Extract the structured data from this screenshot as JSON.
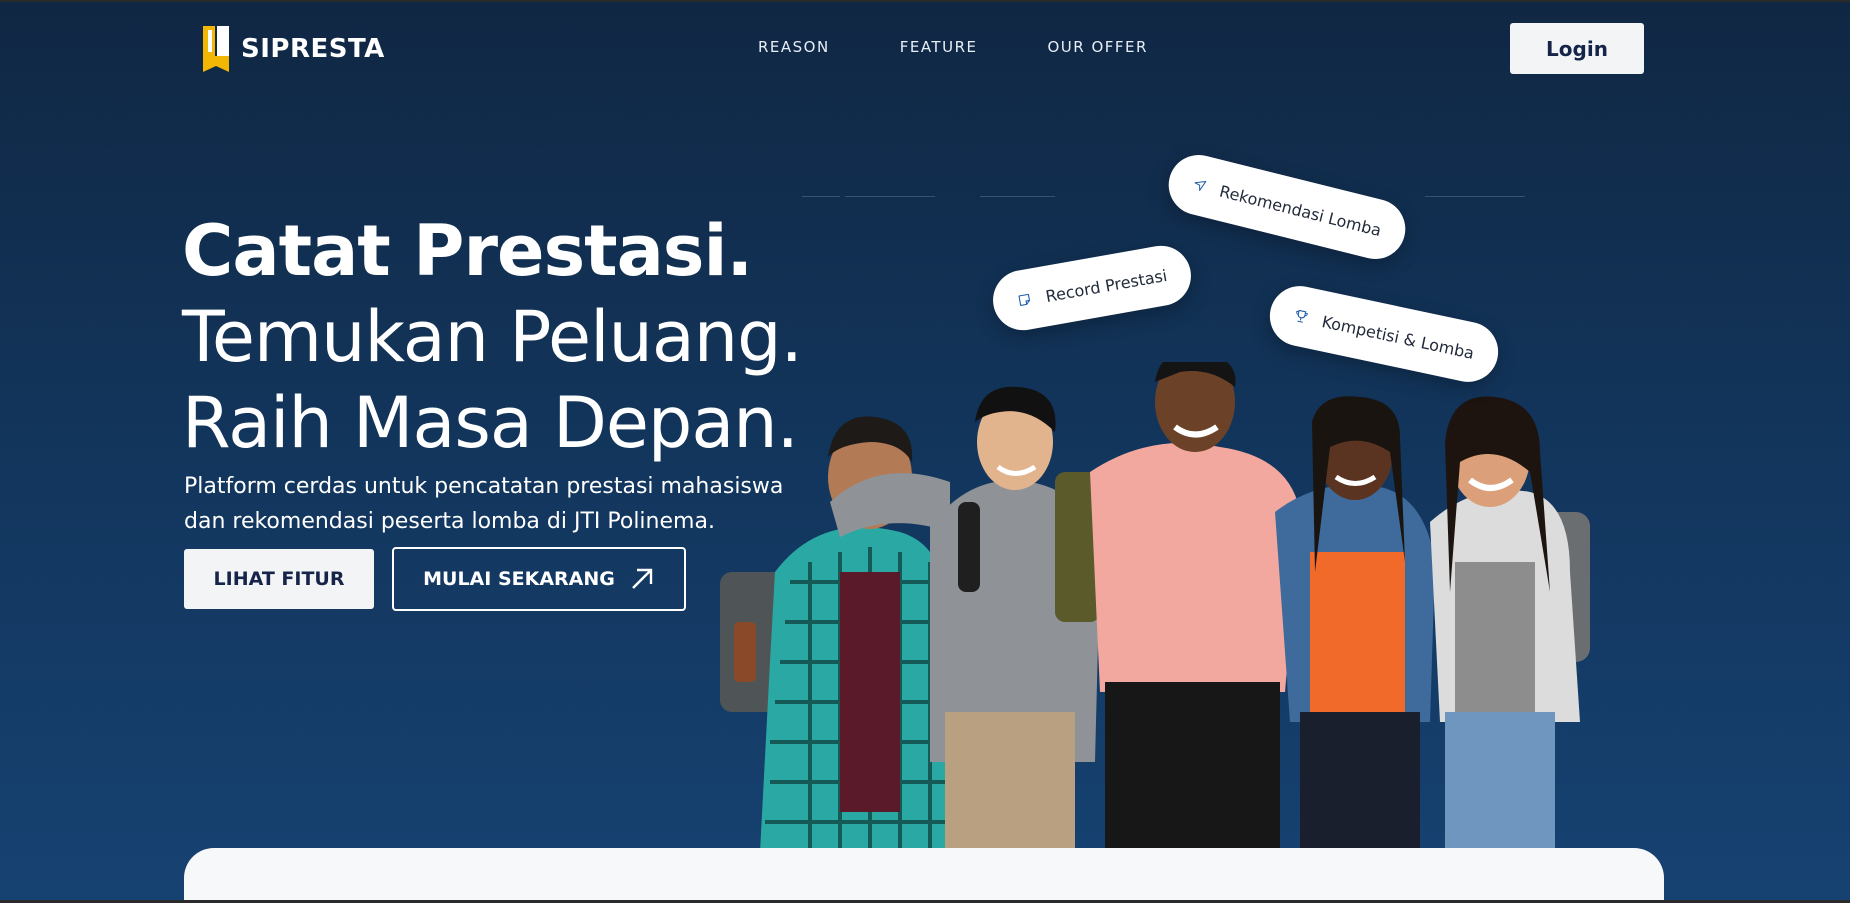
{
  "brand": {
    "name": "SIPRESTA"
  },
  "nav": {
    "links": [
      "REASON",
      "FEATURE",
      "OUR OFFER"
    ],
    "login_label": "Login"
  },
  "hero": {
    "line1": "Catat Prestasi.",
    "line2": "Temukan Peluang.",
    "line3": "Raih Masa Depan.",
    "subtitle_line1": "Platform cerdas untuk pencatatan prestasi mahasiswa",
    "subtitle_line2": "dan rekomendasi peserta lomba di JTI Polinema.",
    "primary_button": "LIHAT FITUR",
    "secondary_button": "MULAI SEKARANG"
  },
  "pills": {
    "rekomendasi": "Rekomendasi Lomba",
    "record": "Record Prestasi",
    "kompetisi": "Kompetisi & Lomba"
  },
  "icons": {
    "logo": "sipresta-logo-icon",
    "arrow": "arrow-up-right-icon",
    "send": "send-icon",
    "note": "note-icon",
    "trophy": "trophy-icon"
  },
  "colors": {
    "background_top": "#102743",
    "background_bottom": "#164272",
    "logo_yellow": "#f2b705",
    "button_text": "#152448",
    "icon_blue": "#1f5fa8"
  }
}
